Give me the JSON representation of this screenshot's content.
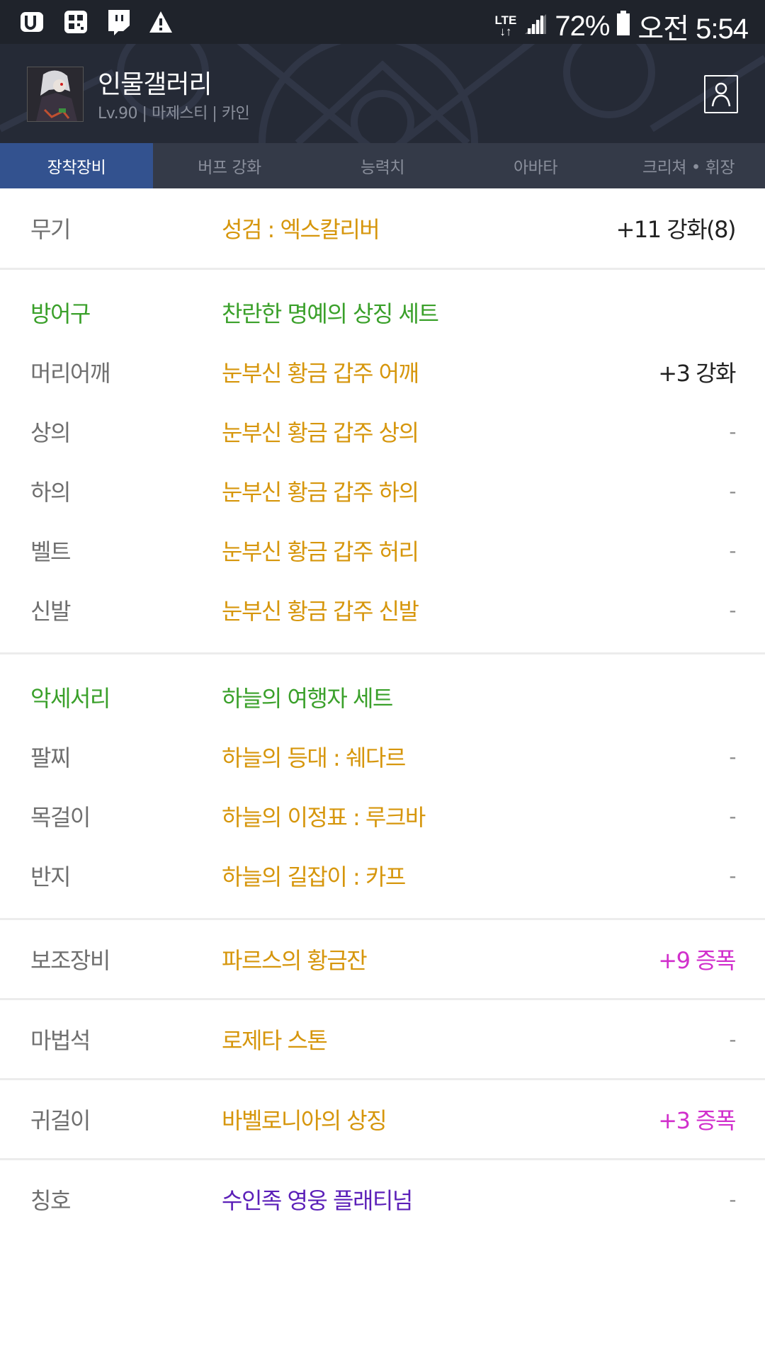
{
  "status_bar": {
    "battery": "72%",
    "time": "오전 5:54",
    "network": "LTE",
    "icons": [
      "u-plus-icon",
      "qr-app-icon",
      "twitch-icon",
      "warning-icon"
    ]
  },
  "header": {
    "title": "인물갤러리",
    "subtitle": "Lv.90 | 마제스티 | 카인"
  },
  "tabs": [
    {
      "label": "장착장비",
      "active": true
    },
    {
      "label": "버프 강화",
      "active": false
    },
    {
      "label": "능력치",
      "active": false
    },
    {
      "label": "아바타",
      "active": false
    },
    {
      "label": "크리쳐 • 휘장",
      "active": false
    }
  ],
  "weapon": {
    "category": "무기",
    "name": "성검 : 엑스칼리버",
    "value": "+11 강화(8)"
  },
  "armor": {
    "category": "방어구",
    "set_name": "찬란한 명예의 상징 세트",
    "items": [
      {
        "category": "머리어깨",
        "name": "눈부신 황금 갑주 어깨",
        "value": "+3 강화"
      },
      {
        "category": "상의",
        "name": "눈부신 황금 갑주 상의",
        "value": "-"
      },
      {
        "category": "하의",
        "name": "눈부신 황금 갑주 하의",
        "value": "-"
      },
      {
        "category": "벨트",
        "name": "눈부신 황금 갑주 허리",
        "value": "-"
      },
      {
        "category": "신발",
        "name": "눈부신 황금 갑주 신발",
        "value": "-"
      }
    ]
  },
  "accessory": {
    "category": "악세서리",
    "set_name": "하늘의 여행자 세트",
    "items": [
      {
        "category": "팔찌",
        "name": "하늘의 등대 : 쉐다르",
        "value": "-"
      },
      {
        "category": "목걸이",
        "name": "하늘의 이정표 : 루크바",
        "value": "-"
      },
      {
        "category": "반지",
        "name": "하늘의 길잡이 : 카프",
        "value": "-"
      }
    ]
  },
  "sub_weapon": {
    "category": "보조장비",
    "name": "파르스의 황금잔",
    "value": "+9 증폭"
  },
  "magic_stone": {
    "category": "마법석",
    "name": "로제타 스톤",
    "value": "-"
  },
  "earring": {
    "category": "귀걸이",
    "name": "바벨로니아의 상징",
    "value": "+3 증폭"
  },
  "title_item": {
    "category": "칭호",
    "name": "수인족 영웅 플래티넘",
    "value": "-"
  },
  "colors": {
    "item_name": "#d6960c",
    "set_name": "#3aa02a",
    "amplify": "#d12fcc",
    "title_name": "#5b1fb8",
    "active_tab": "#33528f"
  }
}
